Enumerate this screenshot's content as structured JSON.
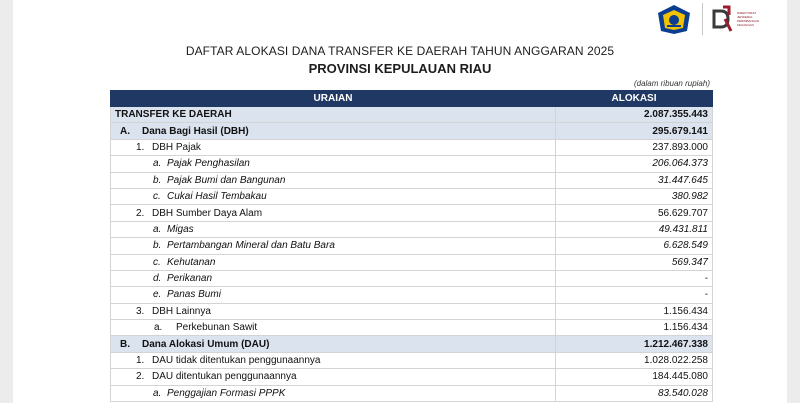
{
  "header": {
    "logo_left": "kementerian-keuangan-logo",
    "logo_right_text": "DIREKTORAT JENDERAL PERIMBANGAN KEUANGAN",
    "title": "DAFTAR ALOKASI DANA TRANSFER KE DAERAH TAHUN ANGGARAN 2025",
    "subtitle": "PROVINSI KEPULAUAN RIAU",
    "unit_note": "(dalam ribuan rupiah)"
  },
  "table": {
    "col_uraian": "URAIAN",
    "col_alokasi": "ALOKASI",
    "rows": [
      {
        "no": "",
        "label": "TRANSFER KE DAERAH",
        "value": "2.087.355.443"
      },
      {
        "no": "A.",
        "label": "Dana Bagi Hasil (DBH)",
        "value": "295.679.141"
      },
      {
        "no": "1.",
        "label": "DBH Pajak",
        "value": "237.893.000"
      },
      {
        "no": "a.",
        "label": "Pajak Penghasilan",
        "value": "206.064.373"
      },
      {
        "no": "b.",
        "label": "Pajak Bumi dan Bangunan",
        "value": "31.447.645"
      },
      {
        "no": "c.",
        "label": "Cukai Hasil Tembakau",
        "value": "380.982"
      },
      {
        "no": "2.",
        "label": "DBH Sumber Daya Alam",
        "value": "56.629.707"
      },
      {
        "no": "a.",
        "label": "Migas",
        "value": "49.431.811"
      },
      {
        "no": "b.",
        "label": "Pertambangan Mineral dan Batu Bara",
        "value": "6.628.549"
      },
      {
        "no": "c.",
        "label": "Kehutanan",
        "value": "569.347"
      },
      {
        "no": "d.",
        "label": "Perikanan",
        "value": "-"
      },
      {
        "no": "e.",
        "label": "Panas Bumi",
        "value": "-"
      },
      {
        "no": "3.",
        "label": "DBH Lainnya",
        "value": "1.156.434"
      },
      {
        "no": "a.",
        "label": "Perkebunan Sawit",
        "value": "1.156.434"
      },
      {
        "no": "B.",
        "label": "Dana Alokasi Umum (DAU)",
        "value": "1.212.467.338"
      },
      {
        "no": "1.",
        "label": "DAU tidak ditentukan penggunaannya",
        "value": "1.028.022.258"
      },
      {
        "no": "2.",
        "label": "DAU ditentukan penggunaannya",
        "value": "184.445.080"
      },
      {
        "no": "a.",
        "label": "Penggajian Formasi PPPK",
        "value": "83.540.028"
      }
    ]
  }
}
